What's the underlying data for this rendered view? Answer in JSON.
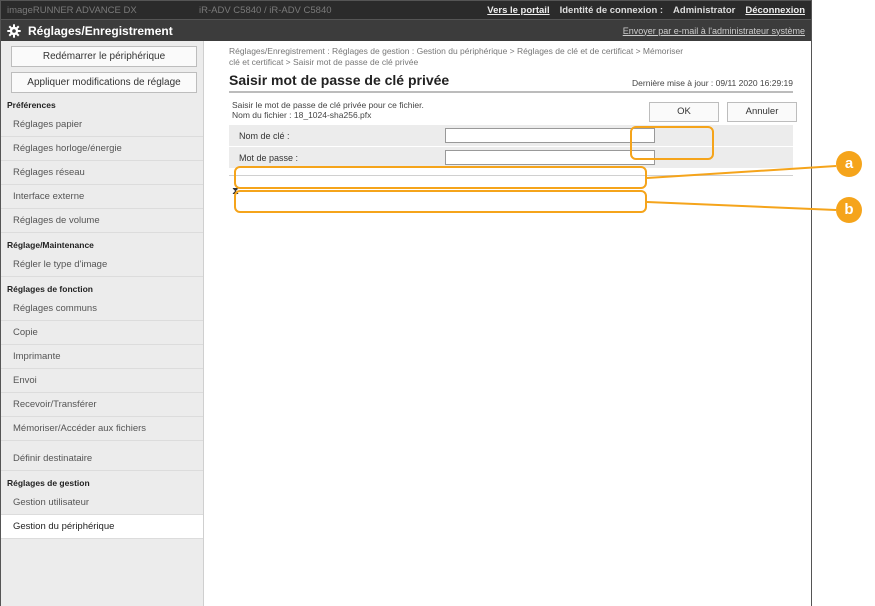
{
  "topbar": {
    "device_left": "imageRUNNER ADVANCE DX",
    "device_mid": "iR-ADV C5840 / iR-ADV C5840",
    "portal_link": "Vers le portail",
    "login_label": "Identité de connexion :",
    "user": "Administrator",
    "logout_link": "Déconnexion"
  },
  "header": {
    "title": "Réglages/Enregistrement",
    "send_mail": "Envoyer par e-mail à l'administrateur système"
  },
  "sidebar": {
    "restart_button": "Redémarrer le périphérique",
    "apply_button": "Appliquer modifications de réglage",
    "sections": [
      {
        "heading": "Préférences",
        "items": [
          "Réglages papier",
          "Réglages horloge/énergie",
          "Réglages réseau",
          "Interface externe",
          "Réglages de volume"
        ]
      },
      {
        "heading": "Réglage/Maintenance",
        "items": [
          "Régler le type d'image"
        ]
      },
      {
        "heading": "Réglages de fonction",
        "items": [
          "Réglages communs",
          "Copie",
          "Imprimante",
          "Envoi",
          "Recevoir/Transférer",
          "Mémoriser/Accéder aux fichiers"
        ]
      },
      {
        "heading": "",
        "items": [
          "Définir destinataire"
        ]
      },
      {
        "heading": "Réglages de gestion",
        "items": [
          "Gestion utilisateur",
          "Gestion du périphérique"
        ]
      }
    ]
  },
  "main": {
    "breadcrumb_line1": "Réglages/Enregistrement : Réglages de gestion : Gestion du périphérique > Réglages de clé et de certificat > Mémoriser",
    "breadcrumb_line2": "clé et certificat > Saisir mot de passe de clé privée",
    "title": "Saisir mot de passe de clé privée",
    "last_update": "Dernière mise à jour : 09/11 2020 16:29:19",
    "desc_line1": "Saisir le mot de passe de clé privée pour ce fichier.",
    "desc_line2": "Nom du fichier : 18_1024-sha256.pfx",
    "ok_button": "OK",
    "cancel_button": "Annuler",
    "fields": [
      {
        "label": "Nom de clé :",
        "value": ""
      },
      {
        "label": "Mot de passe :",
        "value": ""
      }
    ],
    "scroll_top": "⧗"
  },
  "callouts": {
    "a": "a",
    "b": "b"
  },
  "colors": {
    "accent": "#f5a41b",
    "topbar": "#2b2b2b",
    "header": "#3c3c3c",
    "sidebar": "#ececec"
  }
}
